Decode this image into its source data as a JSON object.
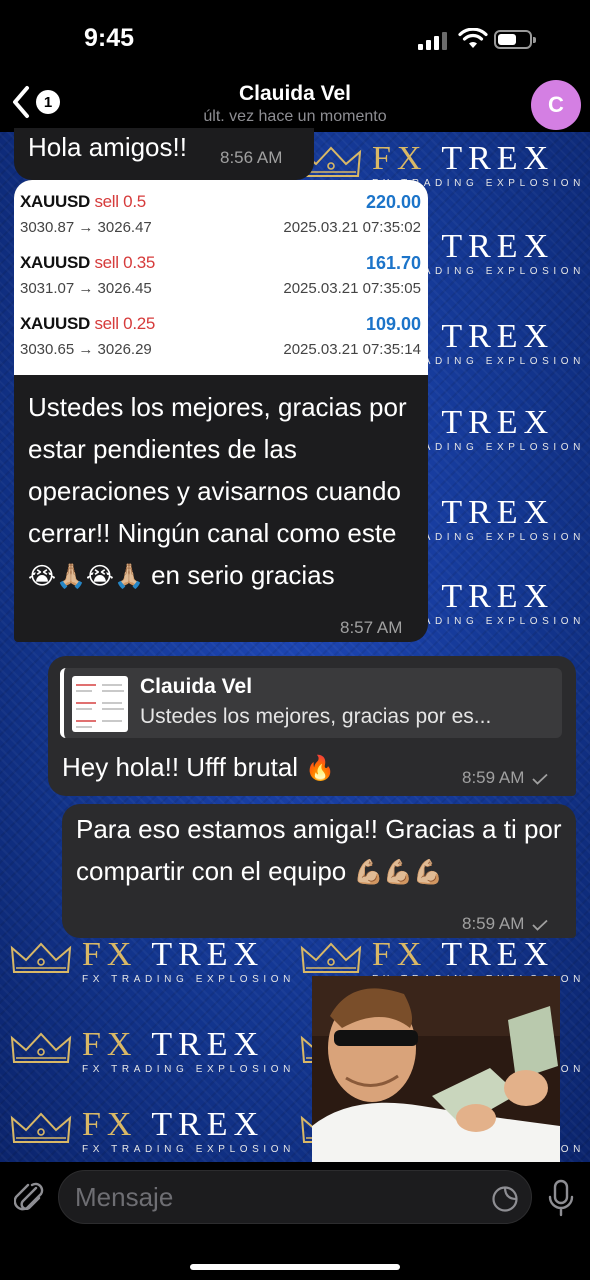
{
  "status_bar": {
    "time": "9:45"
  },
  "header": {
    "back_badge": "1",
    "title": "Clauida Vel",
    "subtitle": "últ. vez hace un momento",
    "avatar_initial": "C",
    "avatar_color": "#d47fe3"
  },
  "wallpaper": {
    "brand_prefix": "FX",
    "brand_name": "TREX",
    "brand_sub": "FX TRADING EXPLOSION",
    "accent_gold": "#d9b866",
    "background": "#1a3fa8"
  },
  "messages": [
    {
      "text": "Hola amigos!!",
      "time": "8:56 AM"
    },
    {
      "trades": [
        {
          "symbol": "XAUUSD",
          "side": "sell 0.5",
          "profit": "220.00",
          "prices": "3030.87 → 3026.47",
          "date": "2025.03.21 07:35:02"
        },
        {
          "symbol": "XAUUSD",
          "side": "sell 0.35",
          "profit": "161.70",
          "prices": "3031.07 → 3026.45",
          "date": "2025.03.21 07:35:05"
        },
        {
          "symbol": "XAUUSD",
          "side": "sell 0.25",
          "profit": "109.00",
          "prices": "3030.65 → 3026.29",
          "date": "2025.03.21 07:35:14"
        }
      ],
      "text": "Ustedes los mejores, gracias por estar pendientes de las operaciones y avisarnos cuando cerrar!!  Ningún canal como este",
      "emojis": "😭🙏🏼😭🙏🏼",
      "text_end": "en serio gracias",
      "time": "8:57 AM"
    },
    {
      "quote_name": "Clauida Vel",
      "quote_text": "Ustedes los mejores, gracias por es...",
      "text": "Hey hola!! Ufff brutal",
      "emoji": "🔥",
      "time": "8:59 AM"
    },
    {
      "text": "Para eso estamos amiga!! Gracias a ti por compartir con el equipo",
      "emojis": "💪🏼💪🏼💪🏼",
      "time": "8:59 AM"
    }
  ],
  "input": {
    "placeholder": "Mensaje"
  }
}
